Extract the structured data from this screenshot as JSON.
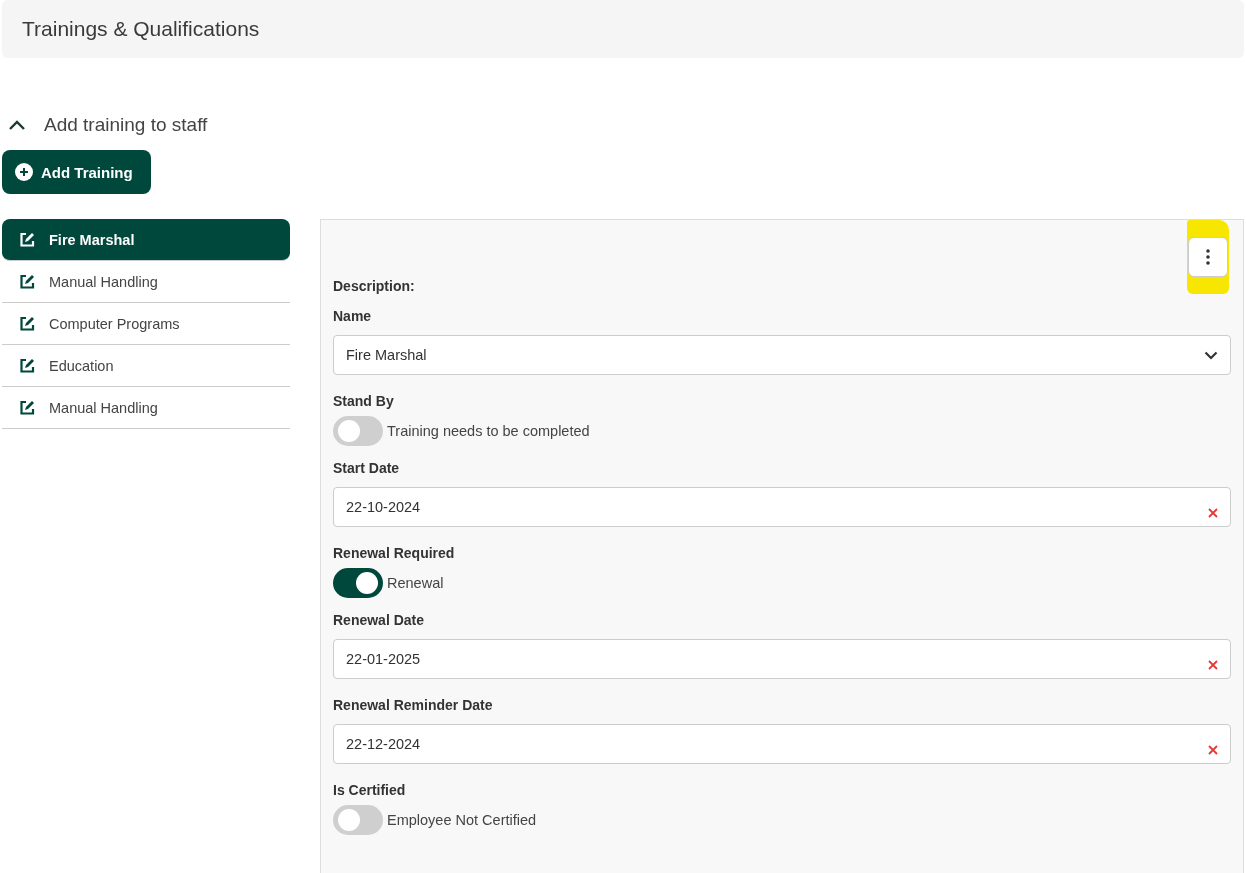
{
  "header": {
    "title": "Trainings & Qualifications"
  },
  "section": {
    "title": "Add training to staff",
    "expanded": true
  },
  "add_button": {
    "label": "Add Training"
  },
  "trainings": [
    {
      "label": "Fire Marshal",
      "selected": true
    },
    {
      "label": "Manual Handling",
      "selected": false
    },
    {
      "label": "Computer Programs",
      "selected": false
    },
    {
      "label": "Education",
      "selected": false
    },
    {
      "label": "Manual Handling",
      "selected": false
    }
  ],
  "form": {
    "heading": "Description:",
    "menu_highlighted": true,
    "fields": [
      {
        "kind": "select",
        "label": "Name",
        "value": "Fire Marshal"
      },
      {
        "kind": "toggle",
        "label": "Stand By",
        "text": "Training needs to be completed",
        "on": false
      },
      {
        "kind": "date",
        "label": "Start Date",
        "value": "22-10-2024"
      },
      {
        "kind": "toggle",
        "label": "Renewal Required",
        "text": "Renewal",
        "on": true
      },
      {
        "kind": "date",
        "label": "Renewal Date",
        "value": "22-01-2025"
      },
      {
        "kind": "date",
        "label": "Renewal Reminder Date",
        "value": "22-12-2024"
      },
      {
        "kind": "toggle",
        "label": "Is Certified",
        "text": "Employee Not Certified",
        "on": false
      }
    ]
  }
}
